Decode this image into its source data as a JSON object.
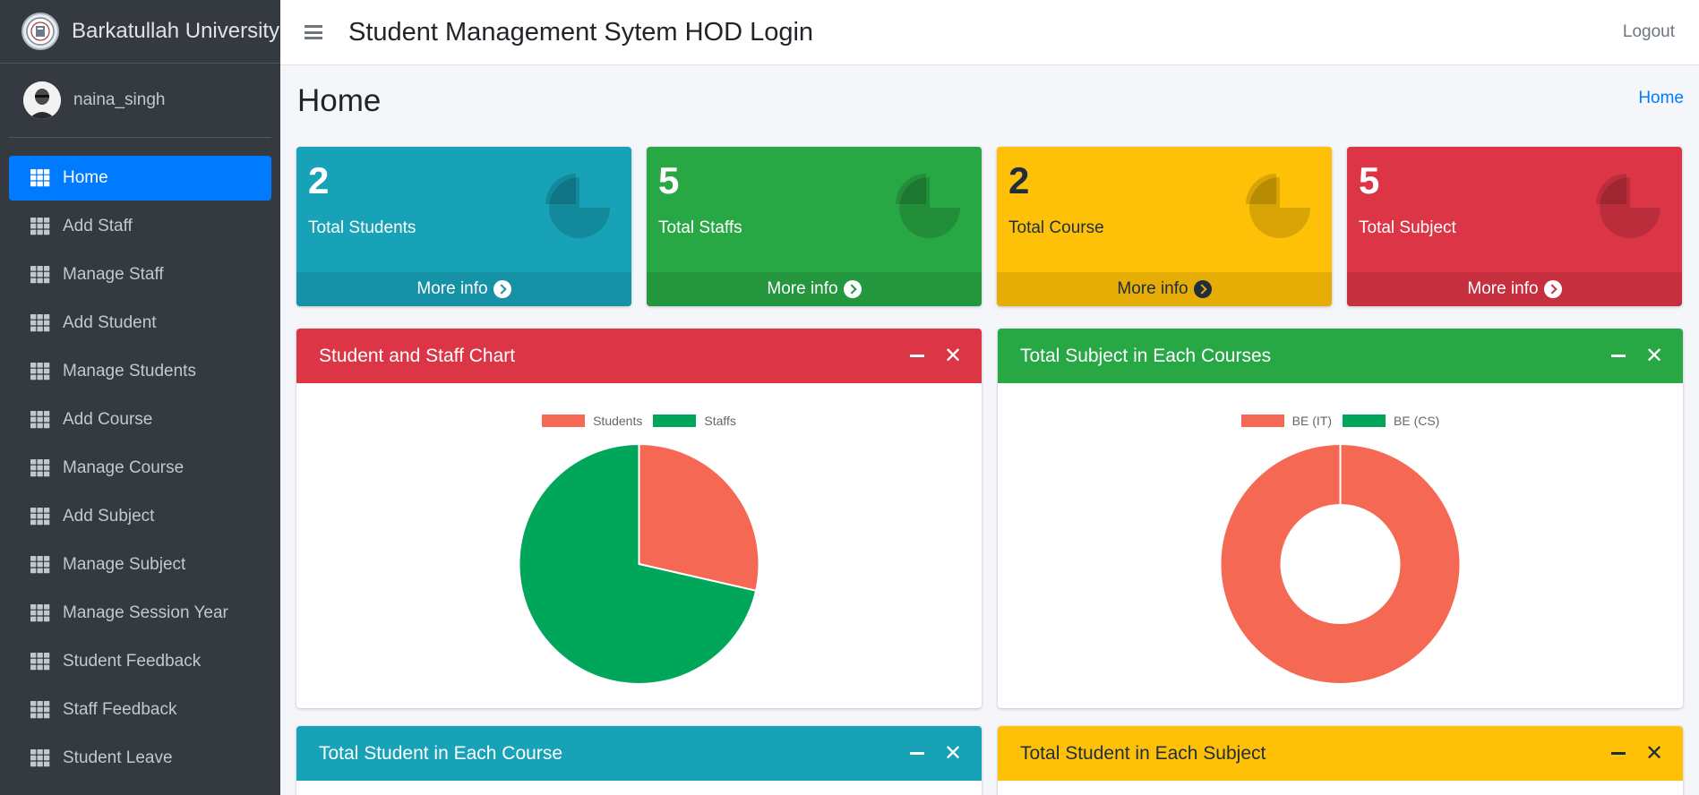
{
  "brand": {
    "name": "Barkatullah University"
  },
  "user": {
    "name": "naina_singh"
  },
  "sidebar": {
    "items": [
      {
        "label": "Home",
        "active": true
      },
      {
        "label": "Add Staff"
      },
      {
        "label": "Manage Staff"
      },
      {
        "label": "Add Student"
      },
      {
        "label": "Manage Students"
      },
      {
        "label": "Add Course"
      },
      {
        "label": "Manage Course"
      },
      {
        "label": "Add Subject"
      },
      {
        "label": "Manage Subject"
      },
      {
        "label": "Manage Session Year"
      },
      {
        "label": "Student Feedback"
      },
      {
        "label": "Staff Feedback"
      },
      {
        "label": "Student Leave"
      }
    ]
  },
  "topbar": {
    "title": "Student Management Sytem HOD Login",
    "logout": "Logout"
  },
  "page": {
    "title": "Home",
    "breadcrumb": "Home"
  },
  "stats": [
    {
      "value": "2",
      "label": "Total Students",
      "more": "More info",
      "color": "#17a2b8"
    },
    {
      "value": "5",
      "label": "Total Staffs",
      "more": "More info",
      "color": "#28a745"
    },
    {
      "value": "2",
      "label": "Total Course",
      "more": "More info",
      "color": "#ffc107"
    },
    {
      "value": "5",
      "label": "Total Subject",
      "more": "More info",
      "color": "#dc3545"
    }
  ],
  "cards": [
    {
      "title": "Student and Staff Chart",
      "color": "#dc3545"
    },
    {
      "title": "Total Subject in Each Courses",
      "color": "#28a745"
    },
    {
      "title": "Total Student in Each Course",
      "color": "#17a2b8"
    },
    {
      "title": "Total Student in Each Subject",
      "color": "#ffc107"
    }
  ],
  "chart_data": [
    {
      "type": "pie",
      "title": "",
      "categories": [
        "Students",
        "Staffs"
      ],
      "values": [
        2,
        5
      ],
      "colors": [
        "#f56954",
        "#00a65a"
      ],
      "legend": "top"
    },
    {
      "type": "pie",
      "variant": "doughnut",
      "title": "",
      "categories": [
        "BE (IT)",
        "BE (CS)"
      ],
      "values": [
        5,
        0
      ],
      "colors": [
        "#f56954",
        "#00a65a"
      ],
      "legend": "top"
    }
  ]
}
